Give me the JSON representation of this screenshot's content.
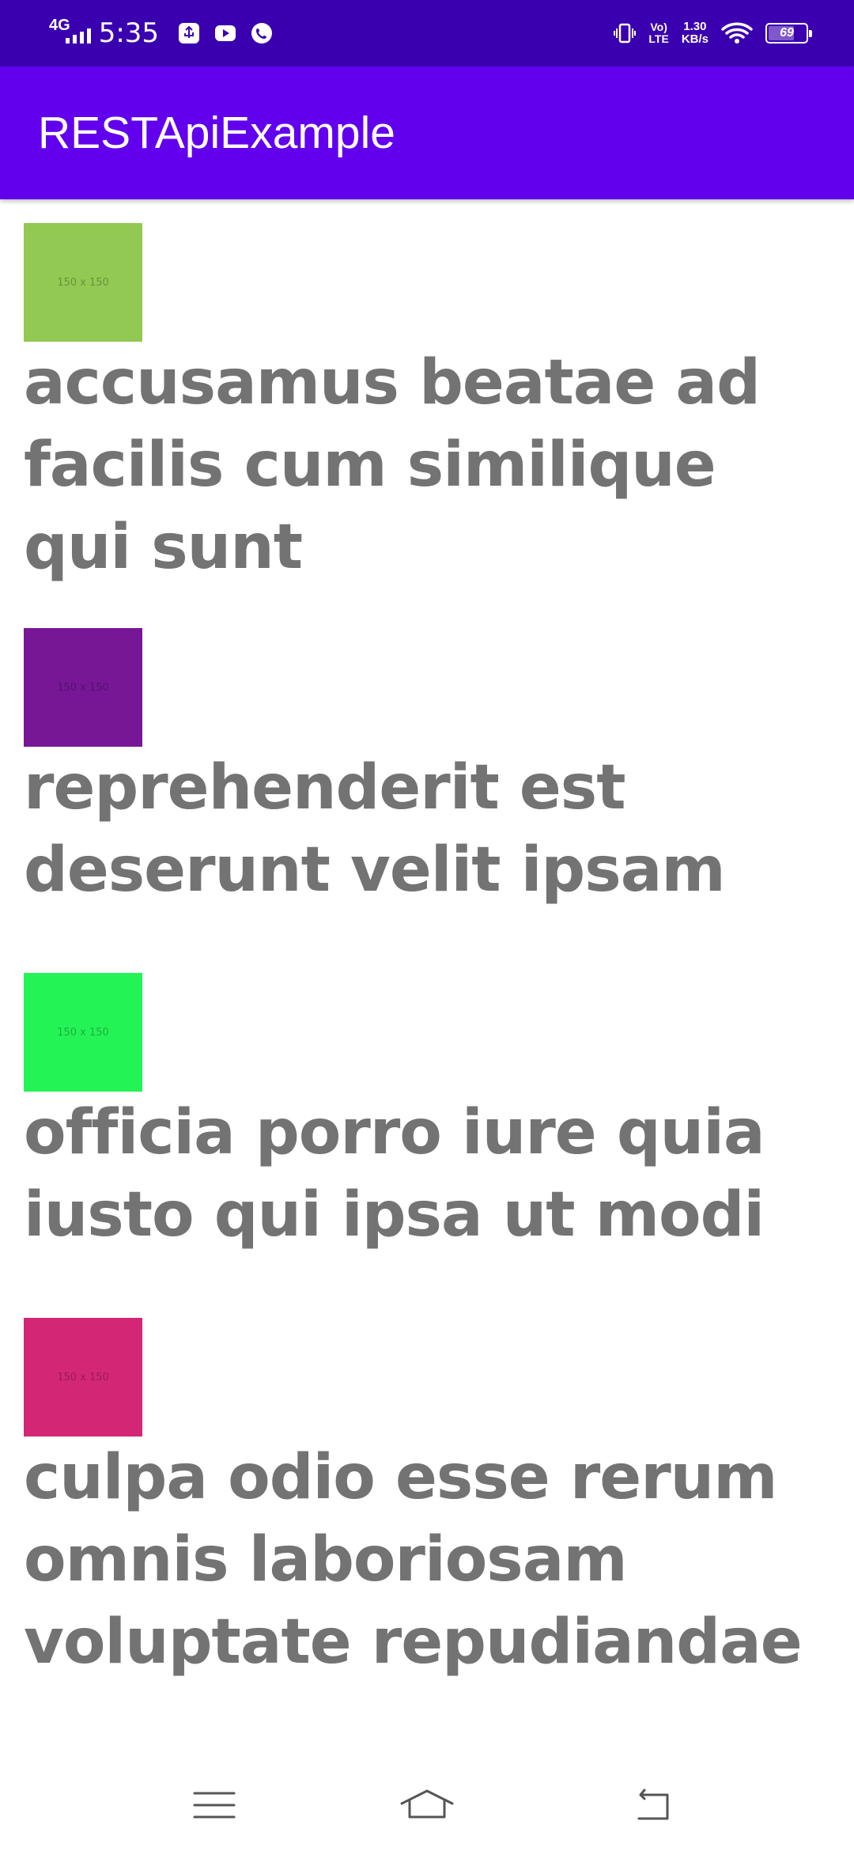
{
  "status_bar": {
    "network_type": "4G",
    "time": "5:35",
    "volte_line1": "Vo)",
    "volte_line2": "LTE",
    "speed_value": "1.30",
    "speed_unit": "KB/s",
    "battery_level": "69",
    "battery_fraction": 0.69
  },
  "app_bar": {
    "title": "RESTApiExample",
    "color": "#6200ee"
  },
  "items": [
    {
      "thumb_color": "#92c952",
      "thumb_label": "150 x 150",
      "title": "accusamus beatae ad facilis cum similique qui sunt"
    },
    {
      "thumb_color": "#771796",
      "thumb_label": "150 x 150",
      "title": "reprehenderit est deserunt velit ipsam"
    },
    {
      "thumb_color": "#24f355",
      "thumb_label": "150 x 150",
      "title": "officia porro iure quia iusto qui ipsa ut modi"
    },
    {
      "thumb_color": "#d32776",
      "thumb_label": "150 x 150",
      "title": "culpa odio esse rerum omnis laboriosam voluptate repudiandae"
    }
  ],
  "nav_bar": {
    "icons": [
      "menu-icon",
      "home-icon",
      "back-icon"
    ]
  }
}
